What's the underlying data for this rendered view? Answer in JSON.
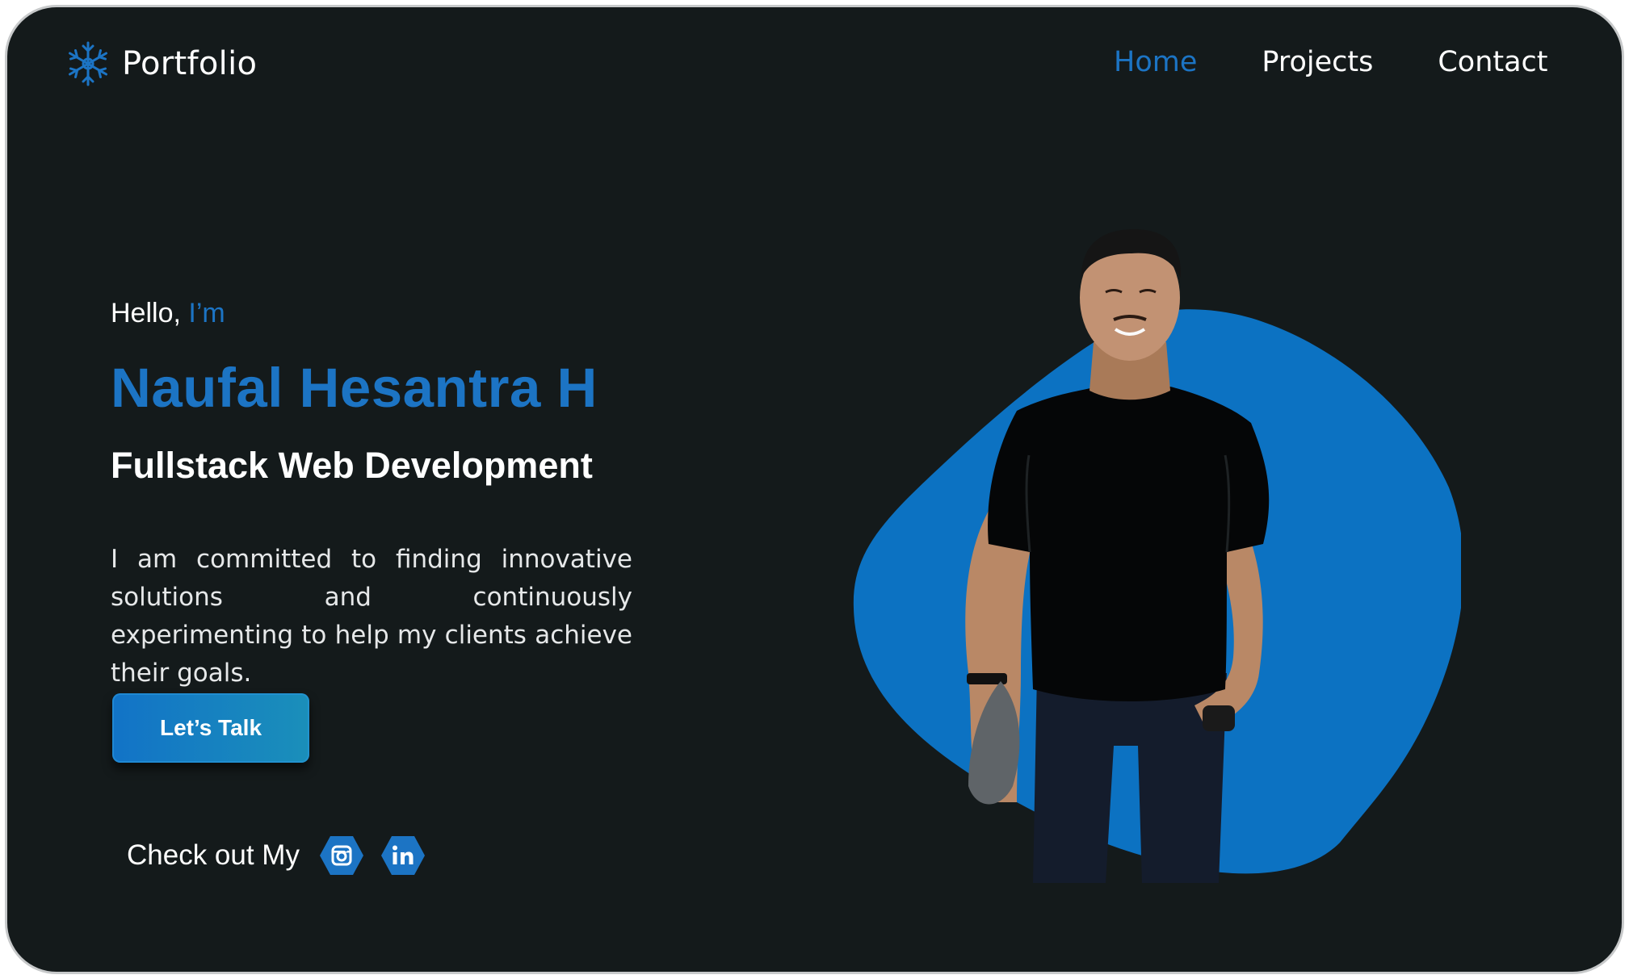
{
  "brand": {
    "name": "Portfolio",
    "icon": "snowflake-icon"
  },
  "nav": {
    "items": [
      {
        "label": "Home",
        "active": true
      },
      {
        "label": "Projects",
        "active": false
      },
      {
        "label": "Contact",
        "active": false
      }
    ]
  },
  "hero": {
    "greeting_prefix": "Hello,",
    "greeting_accent": "I’m",
    "name": "Naufal Hesantra H",
    "role": "Fullstack Web Development",
    "description": "I am committed to finding innovative solutions and continuously experimenting to help my clients achieve their goals.",
    "cta_label": "Let’s Talk",
    "social_label": "Check out My",
    "social_links": [
      {
        "icon": "instagram-icon"
      },
      {
        "icon": "linkedin-icon"
      }
    ]
  },
  "colors": {
    "background": "#141a1b",
    "accent": "#1c74c4",
    "blob": "#0c72c2",
    "text": "#ffffff"
  }
}
